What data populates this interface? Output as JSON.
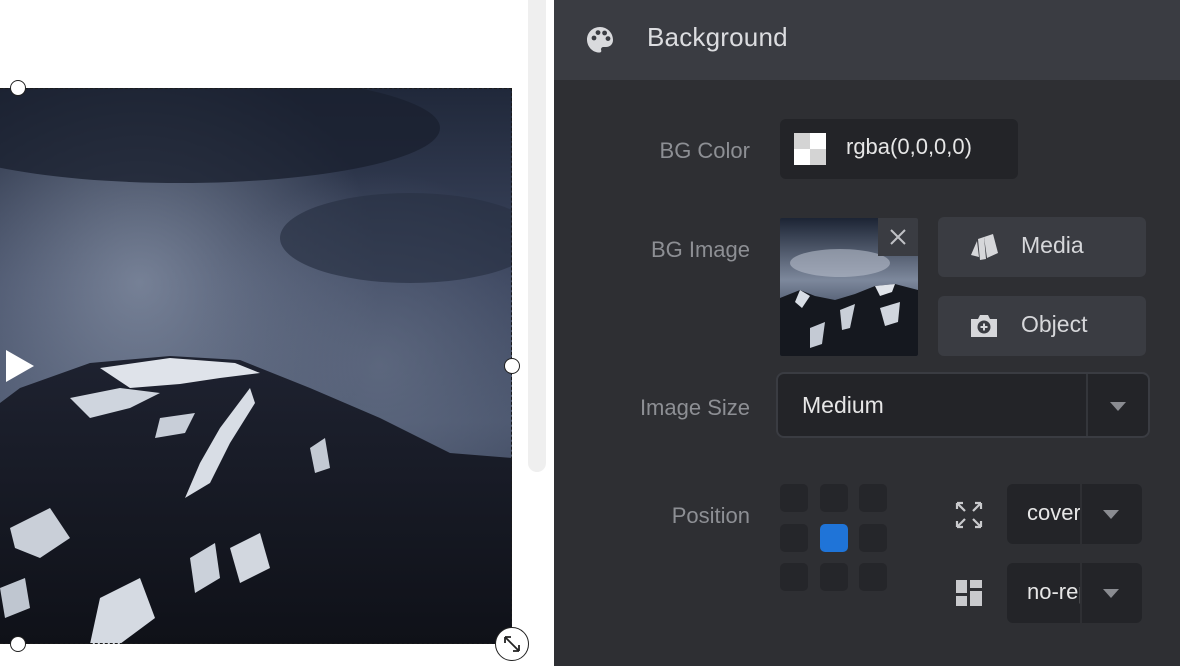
{
  "panel": {
    "title": "Background",
    "icon": "palette-icon"
  },
  "bg_color": {
    "label": "BG Color",
    "value": "rgba(0,0,0,0)"
  },
  "bg_image": {
    "label": "BG Image",
    "remove_icon": "close-icon",
    "media_button": {
      "label": "Media",
      "icon": "media-cards-icon"
    },
    "object_button": {
      "label": "Object",
      "icon": "camera-plus-icon"
    }
  },
  "image_size": {
    "label": "Image Size",
    "value": "Medium"
  },
  "position": {
    "label": "Position",
    "grid": [
      "top-left",
      "top-center",
      "top-right",
      "center-left",
      "center-center",
      "center-right",
      "bottom-left",
      "bottom-center",
      "bottom-right"
    ],
    "selected": "center-center",
    "size_select": {
      "value": "cover",
      "icon": "fit-expand-icon"
    },
    "repeat_select": {
      "value": "no-repeat",
      "icon": "layout-tiles-icon"
    }
  },
  "colors": {
    "panel_bg": "#2e2f33",
    "header_bg": "#3a3c42",
    "field_bg": "#232428",
    "accent": "#1f74d8",
    "label": "#8d8f94"
  }
}
